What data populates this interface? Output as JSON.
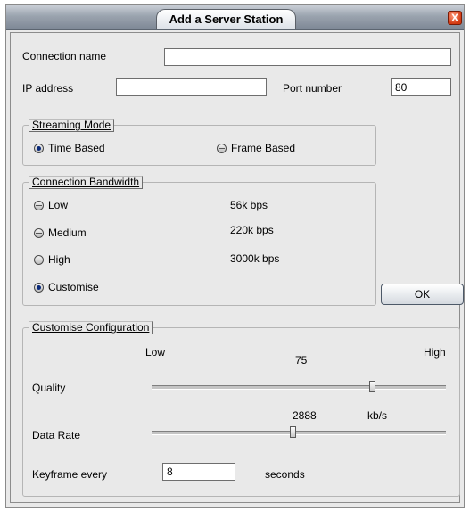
{
  "window": {
    "title": "Add a Server Station",
    "close_label": "X"
  },
  "connection": {
    "name_label": "Connection name",
    "name_value": "",
    "ip_label": "IP address",
    "ip_value": "",
    "port_label": "Port number",
    "port_value": "80"
  },
  "streaming_mode": {
    "legend": "Streaming Mode",
    "options": [
      {
        "label": "Time Based",
        "selected": true
      },
      {
        "label": "Frame Based",
        "selected": false
      }
    ]
  },
  "bandwidth": {
    "legend": "Connection Bandwidth",
    "options": [
      {
        "label": "Low",
        "rate": "56k bps",
        "selected": false
      },
      {
        "label": "Medium",
        "rate": "220k bps",
        "selected": false
      },
      {
        "label": "High",
        "rate": "3000k bps",
        "selected": false
      },
      {
        "label": "Customise",
        "rate": "",
        "selected": true
      }
    ]
  },
  "ok_label": "OK",
  "customise": {
    "legend": "Customise Configuration",
    "low_label": "Low",
    "high_label": "High",
    "quality_label": "Quality",
    "quality_value": "75",
    "quality_fraction": 0.75,
    "data_rate_label": "Data Rate",
    "data_rate_value": "2888",
    "data_rate_unit": "kb/s",
    "data_rate_fraction": 0.48,
    "keyframe_label": "Keyframe every",
    "keyframe_value": "8",
    "keyframe_unit": "seconds"
  }
}
